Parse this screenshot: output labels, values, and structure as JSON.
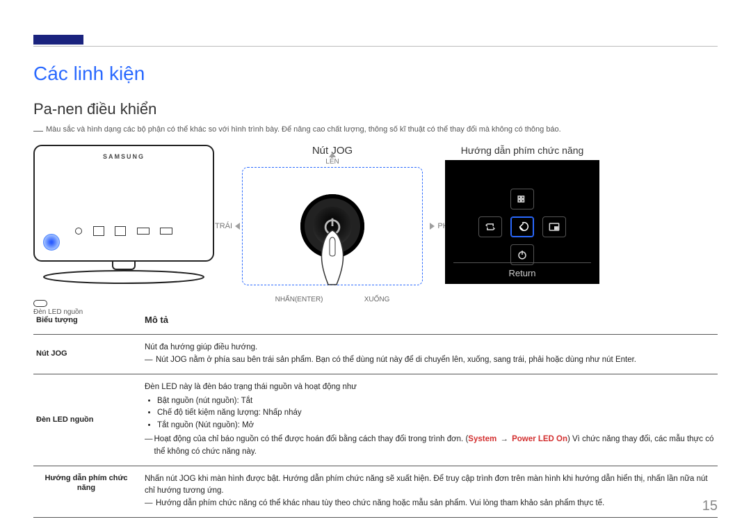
{
  "page_number": "15",
  "chapter_title": "Các linh kiện",
  "section_title": "Pa-nen điều khiển",
  "top_note": "Màu sắc và hình dạng các bộ phận có thể khác so với hình trình bày. Để nâng cao chất lượng, thông số kĩ thuật có thể thay đổi mà không có thông báo.",
  "monitor": {
    "logo": "SAMSUNG",
    "led_caption": "Đèn LED nguồn"
  },
  "jog": {
    "title": "Nút JOG",
    "labels": {
      "up": "LÊN",
      "down": "XUỐNG",
      "left": "TRÁI",
      "right": "PHẢI",
      "enter": "NHẤN(ENTER)"
    }
  },
  "osd": {
    "title": "Hướng dẫn phím chức năng",
    "return_label": "Return",
    "icons": {
      "top": "menu-grid-icon",
      "left": "source-loop-icon",
      "center": "back-icon",
      "right": "pip-icon",
      "bottom": "power-icon"
    }
  },
  "table": {
    "headers": {
      "col1": "Biểu tượng",
      "col2": "Mô tả"
    },
    "rows": [
      {
        "label": "Nút JOG",
        "line1": "Nút đa hướng giúp điều hướng.",
        "note": "Nút JOG nằm ở phía sau bên trái sản phẩm. Bạn có thể dùng nút này để di chuyển lên, xuống, sang trái, phải hoặc dùng như nút Enter."
      },
      {
        "label": "Đèn LED nguồn",
        "line1": "Đèn LED này là đèn báo trạng thái nguồn và hoạt động như",
        "bullets": [
          "Bật nguồn (nút nguồn): Tắt",
          "Chế độ tiết kiệm năng lượng: Nhấp nháy",
          "Tắt nguồn (Nút nguồn): Mở"
        ],
        "note_pre": "Hoạt động của chỉ báo nguồn có thể được hoán đổi bằng cách thay đổi trong trình đơn. (",
        "note_red_a": "System",
        "note_arrow": "→",
        "note_red_b": "Power LED On",
        "note_post": ") Vì chức năng thay đổi, các mẫu thực có thể không có chức năng này."
      },
      {
        "label": "Hướng dẫn phím chức năng",
        "line1": "Nhấn nút JOG khi màn hình được bật. Hướng dẫn phím chức năng sẽ xuất hiện. Để truy cập trình đơn trên màn hình khi hướng dẫn hiển thị, nhấn lần nữa nút chỉ hướng tương ứng.",
        "note": "Hướng dẫn phím chức năng có thể khác nhau tùy theo chức năng hoặc mẫu sản phẩm. Vui lòng tham khảo sản phẩm thực tế."
      }
    ]
  }
}
